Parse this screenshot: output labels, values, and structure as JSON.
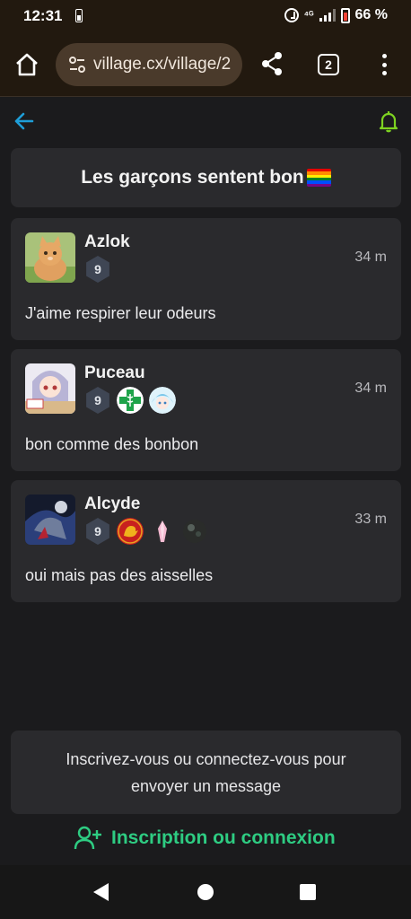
{
  "status_bar": {
    "time": "12:31",
    "battery": "66 %"
  },
  "browser": {
    "url": "village.cx/village/2",
    "tab_count": "2"
  },
  "thread": {
    "title": "Les garçons sentent bon",
    "flag_colors": [
      "#e40303",
      "#ff8c00",
      "#ffed00",
      "#008026",
      "#004dff",
      "#750787"
    ]
  },
  "messages": [
    {
      "username": "Azlok",
      "level": "9",
      "time": "34 m",
      "text": "J'aime respirer leur odeurs"
    },
    {
      "username": "Puceau",
      "level": "9",
      "time": "34 m",
      "text": "bon comme des bonbon"
    },
    {
      "username": "Alcyde",
      "level": "9",
      "time": "33 m",
      "text": "oui mais pas des aisselles"
    }
  ],
  "footer": {
    "prompt": "Inscrivez-vous ou connectez-vous pour envoyer un message",
    "link_label": "Inscription ou connexion"
  },
  "colors": {
    "accent_green": "#2ecc82",
    "back_arrow": "#1e9ed8",
    "bell": "#7ed321"
  }
}
